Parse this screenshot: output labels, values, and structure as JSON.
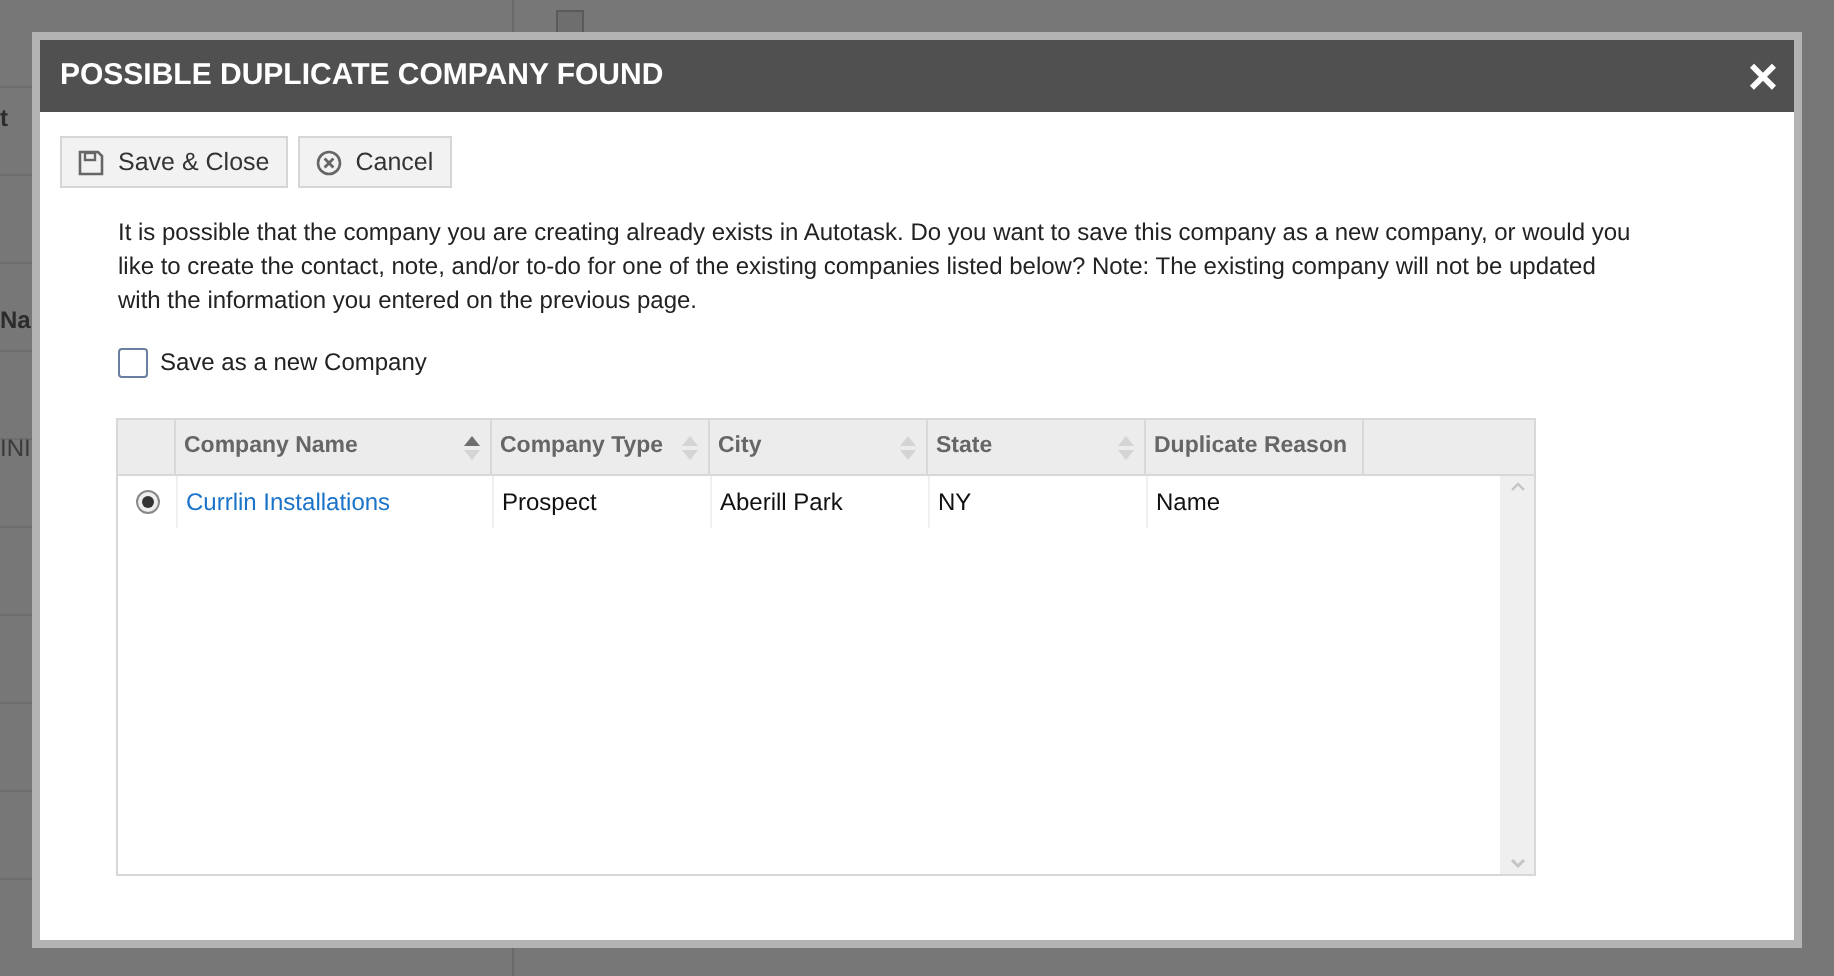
{
  "background": {
    "checkbox_checked": false,
    "fragments": [
      "t",
      "Na",
      "INI"
    ]
  },
  "dialog": {
    "title": "POSSIBLE DUPLICATE COMPANY FOUND",
    "close": "×",
    "toolbar": [
      {
        "kind": "save",
        "label": "Save & Close"
      },
      {
        "kind": "cancel",
        "label": "Cancel"
      }
    ],
    "message": "It is possible that the company you are creating already exists in Autotask. Do you want to save this company as a new company, or would you like to create the contact, note, and/or to-do for one of the existing companies listed below? Note: The existing company will not be updated with the information you entered on the previous page.",
    "save_as_new": {
      "label": "Save as a new Company",
      "checked": false
    },
    "table": {
      "columns": [
        {
          "label": "Company Name",
          "sorted": true
        },
        {
          "label": "Company Type",
          "sorted": false
        },
        {
          "label": "City",
          "sorted": false
        },
        {
          "label": "State",
          "sorted": false
        },
        {
          "label": "Duplicate Reason"
        }
      ],
      "rows": [
        {
          "selected": true,
          "cells": [
            "Currlin Installations",
            "Prospect",
            "Aberill Park",
            "NY",
            "Name"
          ]
        }
      ]
    }
  }
}
